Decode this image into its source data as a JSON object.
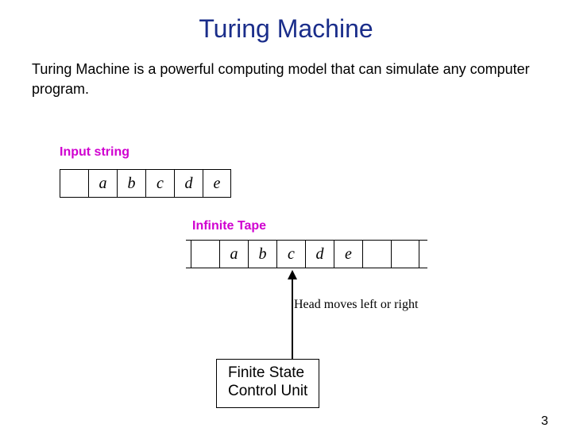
{
  "title": "Turing Machine",
  "description": "Turing Machine is a powerful computing model that can simulate any computer program.",
  "inputLabel": "Input string",
  "tapeLabel": "Infinite Tape",
  "headText": "Head moves left or right",
  "controlLine1": "Finite State",
  "controlLine2": "Control Unit",
  "pageNumber": "3",
  "inputCells": {
    "c0": "",
    "c1": "a",
    "c2": "b",
    "c3": "c",
    "c4": "d",
    "c5": "e"
  },
  "tapeCells": {
    "c0": "",
    "c1": "a",
    "c2": "b",
    "c3": "c",
    "c4": "d",
    "c5": "e",
    "c6": "",
    "c7": ""
  }
}
